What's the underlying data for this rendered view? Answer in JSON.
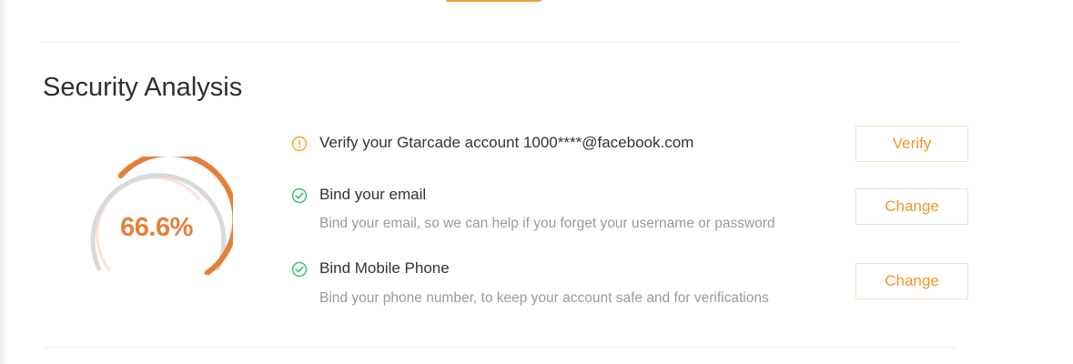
{
  "section": {
    "title": "Security Analysis"
  },
  "gauge": {
    "value": "66.6%",
    "fraction": 0.666,
    "colors": {
      "progress": "#e5803b",
      "track": "#d9d9d9",
      "inner": "#fbe3d6"
    }
  },
  "items": [
    {
      "status": "warning",
      "icon": "warning-circle-icon",
      "label": "Verify your Gtarcade account 1000****@facebook.com",
      "description": "",
      "action": "Verify"
    },
    {
      "status": "ok",
      "icon": "check-circle-icon",
      "label": "Bind your email",
      "description": "Bind your email, so we can help if you forget your username or password",
      "action": "Change"
    },
    {
      "status": "ok",
      "icon": "check-circle-icon",
      "label": "Bind Mobile Phone",
      "description": "Bind your phone number, to keep your account safe and for verifications",
      "action": "Change"
    }
  ],
  "colors": {
    "accent": "#f1962a",
    "warning": "#f3a72f",
    "success": "#3ec36d",
    "button_border": "#f3e1c6"
  }
}
